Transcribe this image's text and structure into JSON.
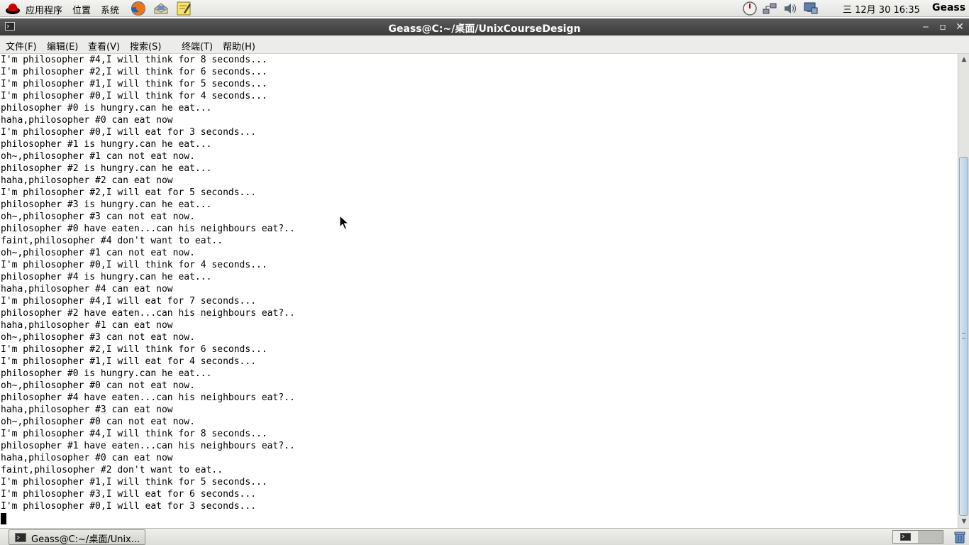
{
  "panel": {
    "menus": [
      {
        "label": "应用程序",
        "icon": "redhat-logo-icon"
      },
      {
        "label": "位置"
      },
      {
        "label": "系统"
      }
    ],
    "launchers": [
      "firefox-icon",
      "mail-client-icon",
      "notes-editor-icon"
    ],
    "tray_icons": [
      "clock-applet-icon",
      "network-icon",
      "volume-icon",
      "display-icon"
    ],
    "clock": "三 12月 30 16:35",
    "user": "Geass"
  },
  "window": {
    "title": "Geass@C:~/桌面/UnixCourseDesign",
    "icon": "terminal-icon",
    "controls": {
      "minimize": "‒",
      "maximize": "▫",
      "close": "✕"
    }
  },
  "menubar": {
    "items": [
      {
        "label": "文件(F)"
      },
      {
        "label": "编辑(E)"
      },
      {
        "label": "查看(V)"
      },
      {
        "label": "搜索(S)"
      },
      {
        "label": "终端(T)"
      },
      {
        "label": "帮助(H)"
      }
    ]
  },
  "terminal": {
    "lines": [
      "I'm philosopher #4,I will think for 8 seconds...",
      "I'm philosopher #2,I will think for 6 seconds...",
      "I'm philosopher #1,I will think for 5 seconds...",
      "I'm philosopher #0,I will think for 4 seconds...",
      "philosopher #0 is hungry.can he eat...",
      "haha,philosopher #0 can eat now",
      "I'm philosopher #0,I will eat for 3 seconds...",
      "philosopher #1 is hungry.can he eat...",
      "oh~,philosopher #1 can not eat now.",
      "philosopher #2 is hungry.can he eat...",
      "haha,philosopher #2 can eat now",
      "I'm philosopher #2,I will eat for 5 seconds...",
      "philosopher #3 is hungry.can he eat...",
      "oh~,philosopher #3 can not eat now.",
      "philosopher #0 have eaten...can his neighbours eat?..",
      "faint,philosopher #4 don't want to eat..",
      "oh~,philosopher #1 can not eat now.",
      "I'm philosopher #0,I will think for 4 seconds...",
      "philosopher #4 is hungry.can he eat...",
      "haha,philosopher #4 can eat now",
      "I'm philosopher #4,I will eat for 7 seconds...",
      "philosopher #2 have eaten...can his neighbours eat?..",
      "haha,philosopher #1 can eat now",
      "oh~,philosopher #3 can not eat now.",
      "I'm philosopher #2,I will think for 6 seconds...",
      "I'm philosopher #1,I will eat for 4 seconds...",
      "philosopher #0 is hungry.can he eat...",
      "oh~,philosopher #0 can not eat now.",
      "philosopher #4 have eaten...can his neighbours eat?..",
      "haha,philosopher #3 can eat now",
      "oh~,philosopher #0 can not eat now.",
      "I'm philosopher #4,I will think for 8 seconds...",
      "philosopher #1 have eaten...can his neighbours eat?..",
      "haha,philosopher #0 can eat now",
      "faint,philosopher #2 don't want to eat..",
      "I'm philosopher #1,I will think for 5 seconds...",
      "I'm philosopher #3,I will eat for 6 seconds...",
      "I'm philosopher #0,I will eat for 3 seconds..."
    ]
  },
  "taskbar": {
    "tasks": [
      {
        "label": "Geass@C:~/桌面/Unix...",
        "icon": "terminal-icon"
      }
    ],
    "workspace_icon": "workspace-switcher-icon",
    "trash_icon": "trash-icon"
  },
  "colors": {
    "titlebar": "#4a4a4a",
    "terminal_bg": "#ffffff",
    "terminal_fg": "#000000",
    "scroll_thumb": "#b9cde2"
  }
}
